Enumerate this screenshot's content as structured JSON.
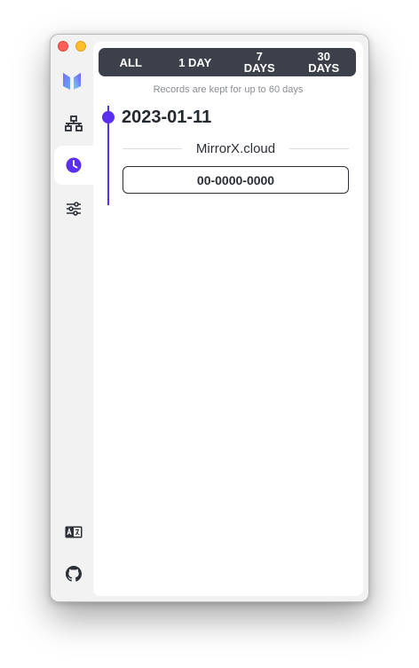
{
  "range_options": [
    {
      "label": "ALL"
    },
    {
      "label": "1 DAY"
    },
    {
      "label": "7\nDAYS"
    },
    {
      "label": "30\nDAYS"
    }
  ],
  "retention_note": "Records are kept for up to 60 days",
  "history": {
    "date": "2023-01-11",
    "domain": "MirrorX.cloud",
    "device_id": "00-0000-0000"
  },
  "colors": {
    "accent": "#5b2ff0",
    "range_bar": "#3b404b"
  },
  "sidebar_icons": [
    "app-logo-icon",
    "network-icon",
    "history-clock-icon",
    "settings-sliders-icon",
    "language-icon",
    "github-icon"
  ]
}
